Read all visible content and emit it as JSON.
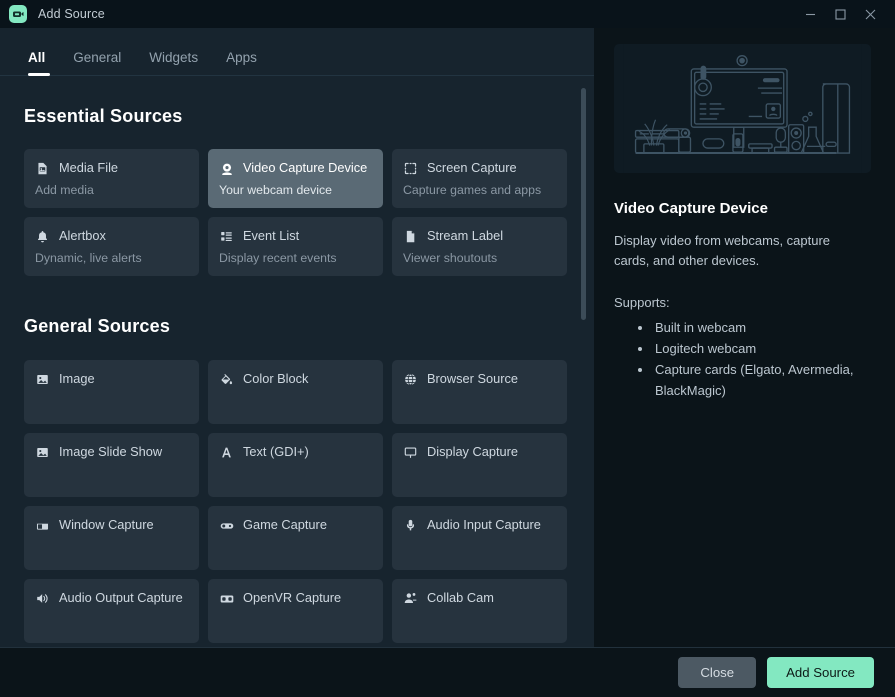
{
  "window": {
    "title": "Add Source",
    "app_icon": "webcam-app-icon",
    "controls": {
      "minimize": "minimize-icon",
      "maximize": "maximize-icon",
      "close": "close-icon"
    }
  },
  "tabs": [
    {
      "label": "All",
      "active": true
    },
    {
      "label": "General",
      "active": false
    },
    {
      "label": "Widgets",
      "active": false
    },
    {
      "label": "Apps",
      "active": false
    }
  ],
  "sections": [
    {
      "title": "Essential Sources",
      "cards": [
        {
          "title": "Media File",
          "subtitle": "Add media",
          "icon": "media-file-icon",
          "selected": false
        },
        {
          "title": "Video Capture Device",
          "subtitle": "Your webcam device",
          "icon": "webcam-icon",
          "selected": true
        },
        {
          "title": "Screen Capture",
          "subtitle": "Capture games and apps",
          "icon": "screen-capture-icon",
          "selected": false
        },
        {
          "title": "Alertbox",
          "subtitle": "Dynamic, live alerts",
          "icon": "bell-icon",
          "selected": false
        },
        {
          "title": "Event List",
          "subtitle": "Display recent events",
          "icon": "list-icon",
          "selected": false
        },
        {
          "title": "Stream Label",
          "subtitle": "Viewer shoutouts",
          "icon": "document-icon",
          "selected": false
        }
      ]
    },
    {
      "title": "General Sources",
      "cards": [
        {
          "title": "Image",
          "subtitle": "",
          "icon": "image-icon",
          "selected": false
        },
        {
          "title": "Color Block",
          "subtitle": "",
          "icon": "paint-bucket-icon",
          "selected": false
        },
        {
          "title": "Browser Source",
          "subtitle": "",
          "icon": "globe-icon",
          "selected": false
        },
        {
          "title": "Image Slide Show",
          "subtitle": "",
          "icon": "image-icon",
          "selected": false
        },
        {
          "title": "Text (GDI+)",
          "subtitle": "",
          "icon": "text-icon",
          "selected": false
        },
        {
          "title": "Display Capture",
          "subtitle": "",
          "icon": "monitor-icon",
          "selected": false
        },
        {
          "title": "Window Capture",
          "subtitle": "",
          "icon": "window-icon",
          "selected": false
        },
        {
          "title": "Game Capture",
          "subtitle": "",
          "icon": "gamepad-icon",
          "selected": false
        },
        {
          "title": "Audio Input Capture",
          "subtitle": "",
          "icon": "microphone-icon",
          "selected": false
        },
        {
          "title": "Audio Output Capture",
          "subtitle": "",
          "icon": "speaker-icon",
          "selected": false
        },
        {
          "title": "OpenVR Capture",
          "subtitle": "",
          "icon": "vr-headset-icon",
          "selected": false
        },
        {
          "title": "Collab Cam",
          "subtitle": "",
          "icon": "people-icon",
          "selected": false
        }
      ]
    }
  ],
  "details": {
    "illustration": "desk-setup-illustration",
    "title": "Video Capture Device",
    "description": "Display video from webcams, capture cards, and other devices.",
    "supports_label": "Supports:",
    "supports": [
      "Built in webcam",
      "Logitech webcam",
      "Capture cards (Elgato, Avermedia, BlackMagic)"
    ]
  },
  "footer": {
    "close_label": "Close",
    "add_label": "Add Source"
  },
  "colors": {
    "accent": "#83e8c1",
    "selected_card": "#5a6a75",
    "card_bg": "#26333e",
    "left_bg": "#17242e",
    "right_bg": "#0b1419"
  }
}
